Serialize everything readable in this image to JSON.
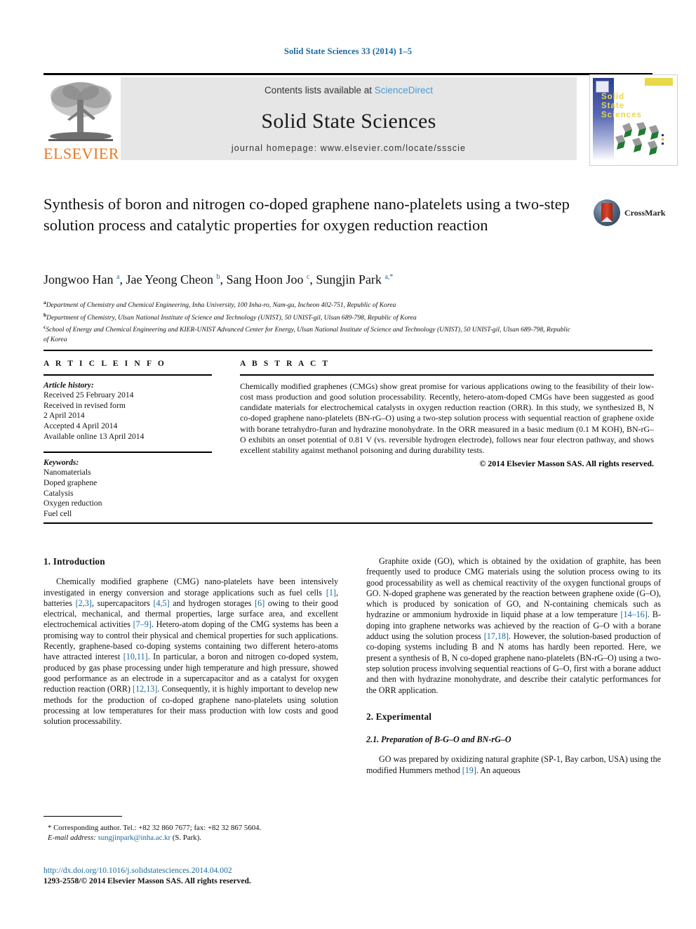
{
  "running_head": "Solid State Sciences 33 (2014) 1–5",
  "masthead": {
    "contents_prefix": "Contents lists available at ",
    "sciencedirect": "ScienceDirect",
    "journal_name": "Solid State Sciences",
    "homepage": "journal homepage: www.elsevier.com/locate/ssscie",
    "publisher_logo_text": "ELSEVIER",
    "cover_title": "Solid\nState\nSciences"
  },
  "crossmark": {
    "label": "CrossMark"
  },
  "article": {
    "title": "Synthesis of boron and nitrogen co-doped graphene nano-platelets using a two-step solution process and catalytic properties for oxygen reduction reaction",
    "authors_html": "Jongwoo Han <sup>a</sup>, Jae Yeong Cheon <sup>b</sup>, Sang Hoon Joo <sup>c</sup>, Sungjin Park <sup>a,*</sup>",
    "affiliations": [
      "Department of Chemistry and Chemical Engineering, Inha University, 100 Inha-ro, Nam-gu, Incheon 402-751, Republic of Korea",
      "Department of Chemistry, Ulsan National Institute of Science and Technology (UNIST), 50 UNIST-gil, Ulsan 689-798, Republic of Korea",
      "School of Energy and Chemical Engineering and KIER-UNIST Advanced Center for Energy, Ulsan National Institute of Science and Technology (UNIST), 50 UNIST-gil, Ulsan 689-798, Republic of Korea"
    ],
    "affiliation_marks": [
      "a",
      "b",
      "c"
    ]
  },
  "article_info": {
    "heading": "A R T I C L E    I N F O",
    "history_label": "Article history:",
    "history": [
      "Received 25 February 2014",
      "Received in revised form",
      "2 April 2014",
      "Accepted 4 April 2014",
      "Available online 13 April 2014"
    ],
    "keywords_label": "Keywords:",
    "keywords": [
      "Nanomaterials",
      "Doped graphene",
      "Catalysis",
      "Oxygen reduction",
      "Fuel cell"
    ]
  },
  "abstract": {
    "heading": "A B S T R A C T",
    "text": "Chemically modified graphenes (CMGs) show great promise for various applications owing to the feasibility of their low-cost mass production and good solution processability. Recently, hetero-atom-doped CMGs have been suggested as good candidate materials for electrochemical catalysts in oxygen reduction reaction (ORR). In this study, we synthesized B, N co-doped graphene nano-platelets (BN-rG–O) using a two-step solution process with sequential reaction of graphene oxide with borane tetrahydro-furan and hydrazine monohydrate. In the ORR measured in a basic medium (0.1 M KOH), BN-rG–O exhibits an onset potential of 0.81 V (vs. reversible hydrogen electrode), follows near four electron pathway, and shows excellent stability against methanol poisoning and during durability tests.",
    "copyright": "© 2014 Elsevier Masson SAS. All rights reserved."
  },
  "body": {
    "intro_heading": "1.  Introduction",
    "intro_p1_parts": [
      "Chemically modified graphene (CMG) nano-platelets have been intensively investigated in energy conversion and storage applications such as fuel cells ",
      "[1]",
      ", batteries ",
      "[2,3]",
      ", supercapacitors ",
      "[4,5]",
      " and hydrogen storages ",
      "[6]",
      " owing to their good electrical, mechanical, and thermal properties, large surface area, and excellent electrochemical activities ",
      "[7–9]",
      ". Hetero-atom doping of the CMG systems has been a promising way to control their physical and chemical properties for such applications. Recently, graphene-based co-doping systems containing two different hetero-atoms have attracted interest ",
      "[10,11]",
      ". In particular, a boron and nitrogen co-doped system, produced by gas phase processing under high temperature and high pressure, showed good performance as an electrode in a supercapacitor and as a catalyst for oxygen reduction reaction (ORR) ",
      "[12,13]",
      ". Consequently, it is highly important to develop new methods for the production of co-doped graphene nano-platelets using solution processing at low temperatures for their mass production with low costs and good solution processability."
    ],
    "right_p1_parts": [
      "Graphite oxide (GO), which is obtained by the oxidation of graphite, has been frequently used to produce CMG materials using the solution process owing to its good processability as well as chemical reactivity of the oxygen functional groups of GO. N-doped graphene was generated by the reaction between graphene oxide (G–O), which is produced by sonication of GO, and N-containing chemicals such as hydrazine or ammonium hydroxide in liquid phase at a low temperature ",
      "[14–16]",
      ". B-doping into graphene networks was achieved by the reaction of G–O with a borane adduct using the solution process ",
      "[17,18]",
      ". However, the solution-based production of co-doping systems including B and N atoms has hardly been reported. Here, we present a synthesis of B, N co-doped graphene nano-platelets (BN-rG–O) using a two-step solution process involving sequential reactions of G–O, first with a borane adduct and then with hydrazine monohydrate, and describe their catalytic performances for the ORR application."
    ],
    "experimental_heading": "2.  Experimental",
    "subsection_heading": "2.1.  Preparation of B-G–O and BN-rG–O",
    "exp_p1_parts": [
      "GO was prepared by oxidizing natural graphite (SP-1, Bay carbon, USA) using the modified Hummers method ",
      "[19]",
      ". An aqueous"
    ]
  },
  "footer": {
    "corresponding": "*  Corresponding author. Tel.: +82 32 860 7677; fax: +82 32 867 5604.",
    "email_label": "E-mail address:",
    "email": "sungjinpark@inha.ac.kr",
    "email_suffix": "(S. Park).",
    "doi": "http://dx.doi.org/10.1016/j.solidstatesciences.2014.04.002",
    "issn_line": "1293-2558/© 2014 Elsevier Masson SAS. All rights reserved."
  },
  "colors": {
    "link": "#1a6a9e",
    "sciencedirect": "#4a9bd5",
    "elsevier_orange": "#e87722",
    "masthead_bg": "#e6e6e6"
  }
}
